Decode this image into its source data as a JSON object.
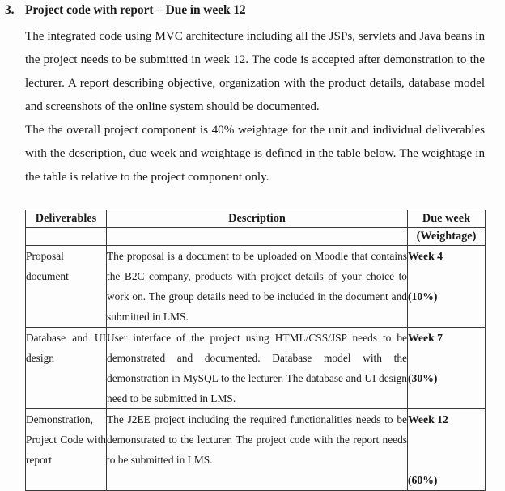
{
  "heading": {
    "number": "3.",
    "text": "Project code with report – Due in week 12"
  },
  "paragraphs": [
    "The integrated code using MVC architecture including all the JSPs, servlets and Java beans in the project needs to be submitted in week 12. The code is accepted after demonstration to the lecturer. A report describing objective, organization with the product details, database model and screenshots of the online system should be documented.",
    "The the overall project component is 40% weightage for the unit and individual deliverables with the description, due week and weightage is defined in the table below. The weightage in the table is relative to the project component only."
  ],
  "table": {
    "headers": {
      "col1": "Deliverables",
      "col2": "Description",
      "col3": "Due week",
      "col3_sub": "(Weightage)",
      "col1_sub": "",
      "col2_sub": ""
    },
    "rows": [
      {
        "deliverable": "Proposal document",
        "description": "The proposal is a document to be uploaded on Moodle that contains the B2C company, products with project details of your choice to work on. The group details need to be included in the document and submitted in LMS.",
        "due_week": "Week 4",
        "weightage": "(10%)"
      },
      {
        "deliverable": "Database and UI design",
        "description": "User interface of the project using HTML/CSS/JSP needs to be demonstrated and documented. Database model with the demonstration in MySQL to the lecturer. The database and UI design need to be submitted in LMS.",
        "due_week": "Week 7",
        "weightage": "(30%)"
      },
      {
        "deliverable": "Demonstration, Project Code with report",
        "description": "The J2EE project including the required functionalities needs to be demonstrated to the lecturer. The project code with the report needs to be submitted in LMS.",
        "due_week": "Week 12",
        "weightage": "(60%)"
      }
    ]
  }
}
